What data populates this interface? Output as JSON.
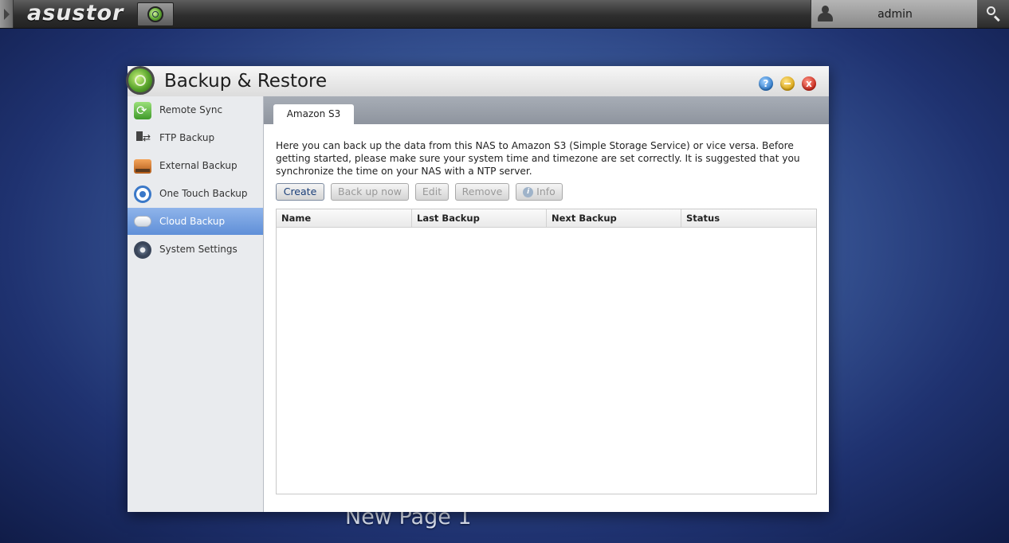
{
  "topbar": {
    "brand": "asustor",
    "user": "admin"
  },
  "desktop": {
    "label": "New Page 1"
  },
  "window": {
    "title": "Backup & Restore",
    "controls": {
      "help": "?",
      "minimize": "",
      "close": "x"
    }
  },
  "sidebar": {
    "items": [
      {
        "label": "Remote Sync",
        "icon": "remote-sync-icon"
      },
      {
        "label": "FTP Backup",
        "icon": "ftp-backup-icon"
      },
      {
        "label": "External Backup",
        "icon": "external-drive-icon"
      },
      {
        "label": "One Touch Backup",
        "icon": "one-touch-icon"
      },
      {
        "label": "Cloud Backup",
        "icon": "cloud-icon",
        "active": true
      },
      {
        "label": "System Settings",
        "icon": "gear-icon"
      }
    ]
  },
  "main": {
    "tab": "Amazon S3",
    "description": "Here you can back up the data from this NAS to Amazon S3 (Simple Storage Service) or vice versa. Before getting started, please make sure your system time and timezone are set correctly. It is suggested that you synchronize the time on your NAS with a NTP server.",
    "toolbar": {
      "create": "Create",
      "backup_now": "Back up now",
      "edit": "Edit",
      "remove": "Remove",
      "info": "Info"
    },
    "table": {
      "columns": [
        "Name",
        "Last Backup",
        "Next Backup",
        "Status"
      ],
      "rows": []
    }
  },
  "colors": {
    "accent": "#5f8fd8",
    "active_item": "#7aa3e3",
    "tab_strip": "#9aa0a9"
  }
}
